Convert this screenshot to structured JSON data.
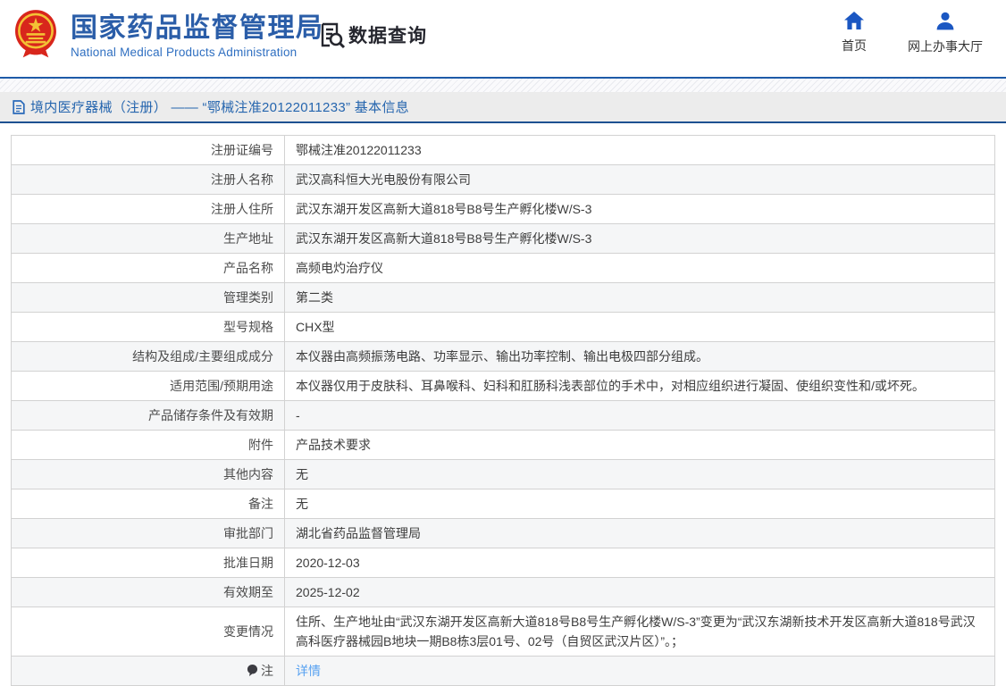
{
  "header": {
    "title": "国家药品监督管理局",
    "subtitle": "National Medical Products Administration",
    "data_query_label": "数据查询",
    "nav": {
      "home_label": "首页",
      "hall_label": "网上办事大厅"
    }
  },
  "breadcrumb": {
    "text": "境内医疗器械（注册） —— “鄂械注准20122011233” 基本信息"
  },
  "colors": {
    "title_blue": "#2a5da8",
    "header_border_blue": "#1e5ba8",
    "breadcrumb_border_blue": "#1d5091",
    "nav_icon_blue": "#1b57c2",
    "link_blue": "#57a1f1",
    "alt_row_gray": "#f5f6f7"
  },
  "table": {
    "rows": [
      {
        "label": "注册证编号",
        "value": "鄂械注准20122011233"
      },
      {
        "label": "注册人名称",
        "value": "武汉高科恒大光电股份有限公司"
      },
      {
        "label": "注册人住所",
        "value": "武汉东湖开发区高新大道818号B8号生产孵化楼W/S-3"
      },
      {
        "label": "生产地址",
        "value": "武汉东湖开发区高新大道818号B8号生产孵化楼W/S-3"
      },
      {
        "label": "产品名称",
        "value": "高频电灼治疗仪"
      },
      {
        "label": "管理类别",
        "value": "第二类"
      },
      {
        "label": "型号规格",
        "value": "CHX型"
      },
      {
        "label": "结构及组成/主要组成成分",
        "value": "本仪器由高频振荡电路、功率显示、输出功率控制、输出电极四部分组成。"
      },
      {
        "label": "适用范围/预期用途",
        "value": "本仪器仅用于皮肤科、耳鼻喉科、妇科和肛肠科浅表部位的手术中，对相应组织进行凝固、使组织变性和/或坏死。"
      },
      {
        "label": "产品储存条件及有效期",
        "value": "-"
      },
      {
        "label": "附件",
        "value": "产品技术要求"
      },
      {
        "label": "其他内容",
        "value": "无"
      },
      {
        "label": "备注",
        "value": "无"
      },
      {
        "label": "审批部门",
        "value": "湖北省药品监督管理局"
      },
      {
        "label": "批准日期",
        "value": "2020-12-03"
      },
      {
        "label": "有效期至",
        "value": "2025-12-02"
      },
      {
        "label": "变更情况",
        "value": "住所、生产地址由“武汉东湖开发区高新大道818号B8号生产孵化楼W/S-3”变更为“武汉东湖新技术开发区高新大道818号武汉高科医疗器械园B地块一期B8栋3层01号、02号（自贸区武汉片区）”。；"
      },
      {
        "label": "注",
        "value": "详情",
        "is_link": true,
        "has_icon": true
      }
    ]
  }
}
